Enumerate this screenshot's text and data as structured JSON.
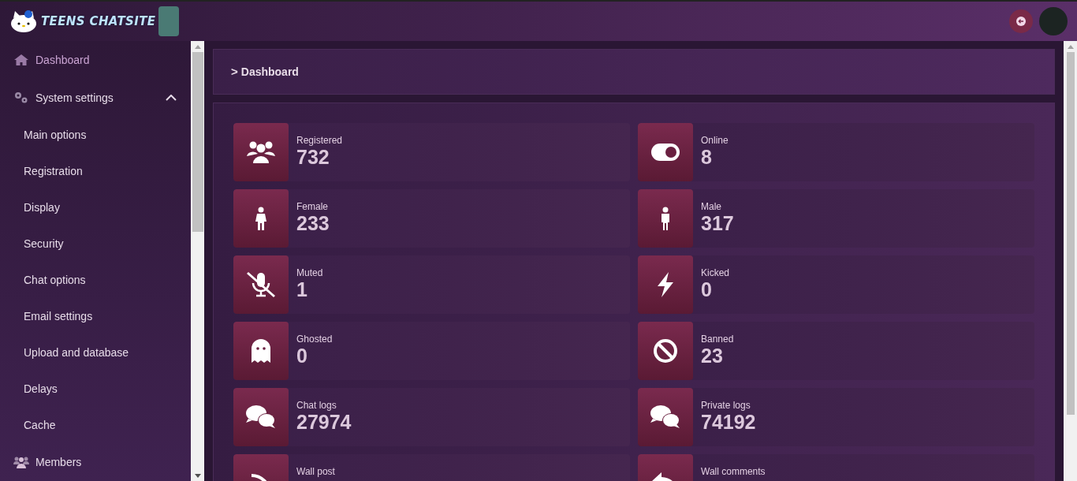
{
  "header": {
    "logo_text": "TEENS CHATSITE"
  },
  "sidebar": {
    "items": [
      {
        "label": "Dashboard",
        "selected": true,
        "kind": "top"
      },
      {
        "label": "System settings",
        "selected": false,
        "kind": "group",
        "expanded": true,
        "children": [
          {
            "label": "Main options",
            "selected": false
          },
          {
            "label": "Registration",
            "selected": false
          },
          {
            "label": "Display",
            "selected": false
          },
          {
            "label": "Security",
            "selected": false
          },
          {
            "label": "Chat options",
            "selected": false
          },
          {
            "label": "Email settings",
            "selected": false
          },
          {
            "label": "Upload and database",
            "selected": false
          },
          {
            "label": "Delays",
            "selected": false
          },
          {
            "label": "Cache",
            "selected": false
          }
        ]
      },
      {
        "label": "Members",
        "selected": false,
        "kind": "top"
      }
    ]
  },
  "breadcrumb": {
    "separator": ">",
    "label": "Dashboard"
  },
  "stats": [
    {
      "label": "Registered",
      "value": "732"
    },
    {
      "label": "Online",
      "value": "8"
    },
    {
      "label": "Female",
      "value": "233"
    },
    {
      "label": "Male",
      "value": "317"
    },
    {
      "label": "Muted",
      "value": "1"
    },
    {
      "label": "Kicked",
      "value": "0"
    },
    {
      "label": "Ghosted",
      "value": "0"
    },
    {
      "label": "Banned",
      "value": "23"
    },
    {
      "label": "Chat logs",
      "value": "27974"
    },
    {
      "label": "Private logs",
      "value": "74192"
    },
    {
      "label": "Wall post"
    },
    {
      "label": "Wall comments"
    }
  ]
}
